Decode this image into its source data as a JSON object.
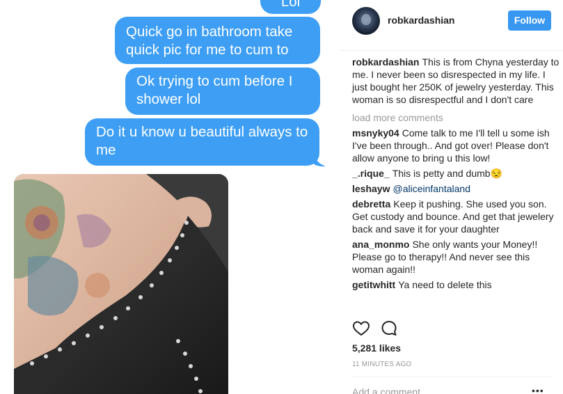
{
  "messages": [
    "Lol",
    "Quick go in bathroom take quick pic for me to cum to",
    "Ok trying to cum before I shower lol",
    "Do it u know u beautiful always to me"
  ],
  "post": {
    "username": "robkardashian",
    "follow_label": "Follow",
    "caption": "This is from Chyna yesterday to me. I never been so disrespected in my life. I just bought her 250K of jewelry yesterday. This woman is so disrespectful and I don't care",
    "load_more": "load more comments",
    "comments": [
      {
        "user": "msnyky04",
        "text": "Come talk to me I'll tell u some ish I've been through.. And got over! Please don't allow anyone to bring u this low!"
      },
      {
        "user": "_.rique_",
        "text": "This is petty and dumb😒"
      },
      {
        "user": "leshayw",
        "text": "@aliceinfantaland"
      },
      {
        "user": "debretta",
        "text": "Keep it pushing. She used you son. Get custody and bounce. And get that jewelery back and save it for your daughter"
      },
      {
        "user": "ana_monmo",
        "text": "She only wants your Money!! Please go to therapy!! And never see this woman again!!"
      },
      {
        "user": "getitwhitt",
        "text": "Ya need to delete this"
      }
    ],
    "likes": "5,281 likes",
    "timestamp": "11 MINUTES AGO",
    "add_comment_placeholder": "Add a comment...",
    "more_label": "•••"
  },
  "icons": {
    "like": "heart-icon",
    "comment": "comment-bubble-icon"
  },
  "colors": {
    "imessage_blue": "#3d9ef3",
    "follow_blue": "#3897f0",
    "mention": "#003569",
    "muted": "#999999"
  }
}
